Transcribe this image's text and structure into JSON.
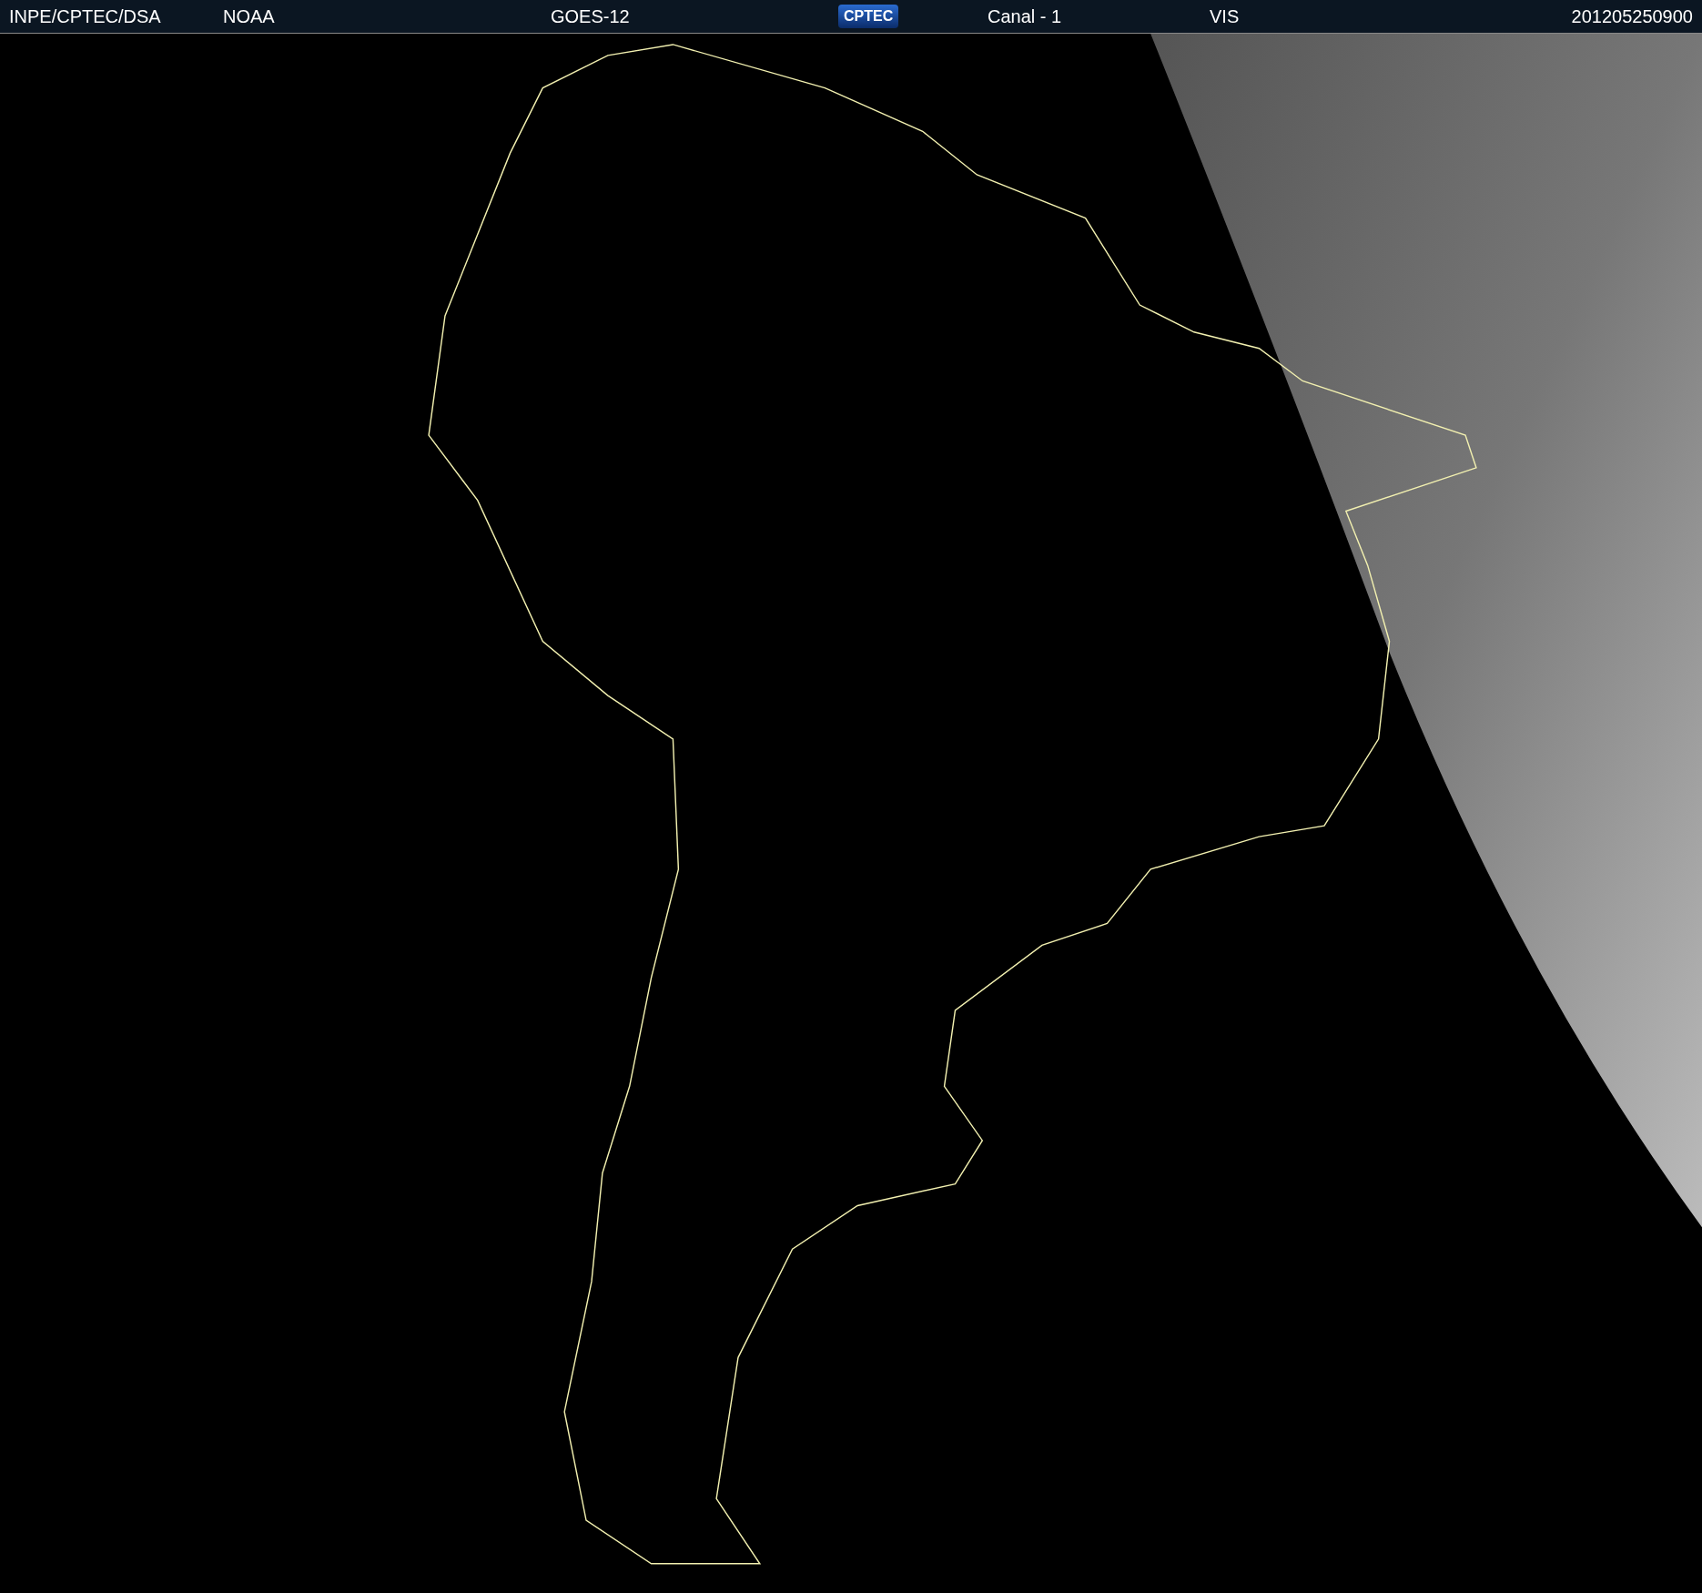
{
  "header": {
    "source": "INPE/CPTEC/DSA",
    "agency": "NOAA",
    "satellite": "GOES-12",
    "logo": "CPTEC",
    "channel": "Canal - 1",
    "band": "VIS",
    "timestamp": "201205250900"
  }
}
